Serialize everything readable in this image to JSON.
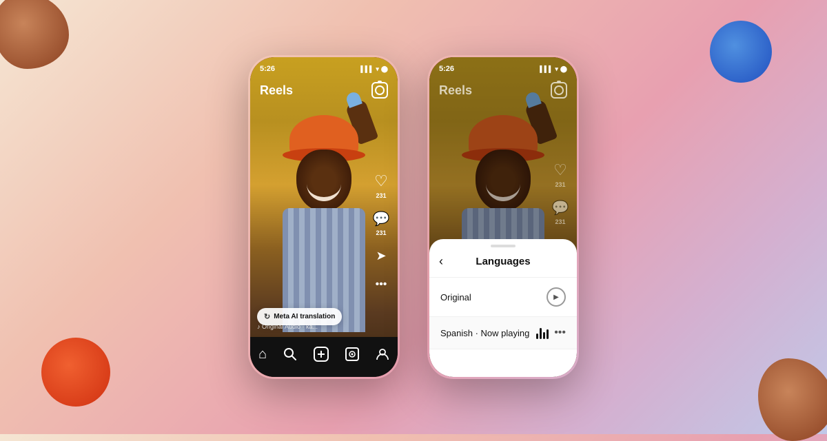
{
  "background": {
    "description": "gradient background with decorative blobs"
  },
  "phone1": {
    "status_bar": {
      "time": "5:26",
      "icons": "▌▌▌ ▾ ●"
    },
    "header": {
      "title": "Reels",
      "camera_label": "camera-icon"
    },
    "ai_button": {
      "label": "Meta AI translation",
      "icon": "↻"
    },
    "actions": {
      "like_count": "231",
      "comment_count": "231"
    },
    "audio": {
      "text": "♪ Original Audio · ka..."
    },
    "nav": {
      "items": [
        "⌂",
        "🔍",
        "⊕",
        "▣",
        "◯"
      ]
    }
  },
  "phone2": {
    "status_bar": {
      "time": "5:26",
      "icons": "▌▌▌ ▾ ●"
    },
    "header": {
      "title": "Reels"
    },
    "lang_panel": {
      "drag_handle": true,
      "title": "Languages",
      "back_button": "‹",
      "original_label": "Original",
      "spanish_label": "Spanish · Now playing",
      "playing_indicator": "bars"
    }
  }
}
